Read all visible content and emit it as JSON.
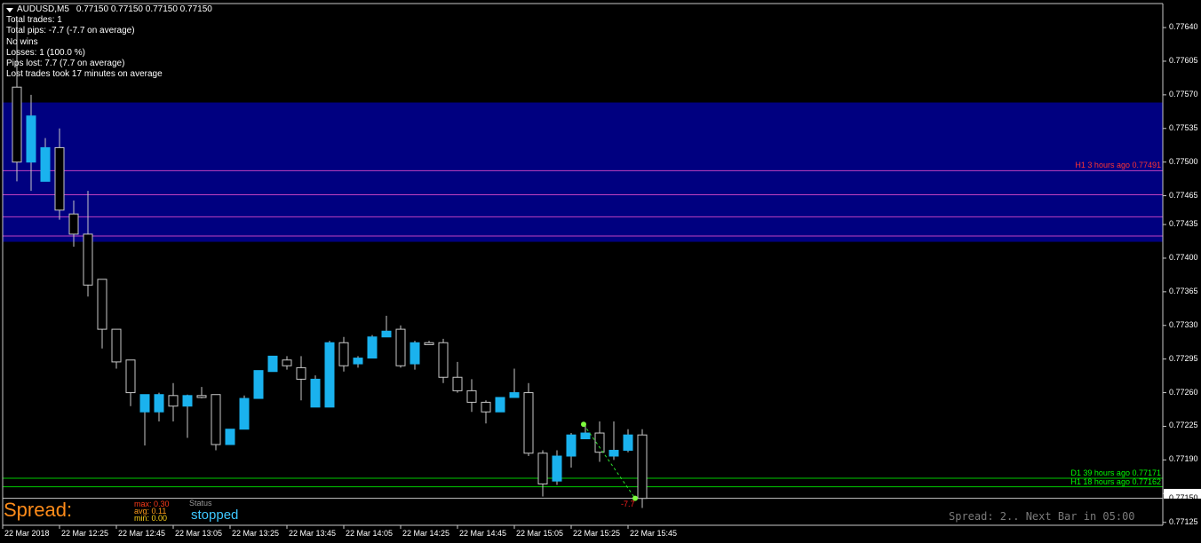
{
  "header": {
    "symbol": "AUDUSD,M5",
    "ohlc": "0.77150 0.77150 0.77150 0.77150",
    "stats": [
      "Total trades: 1",
      "Total pips: -7.7 (-7.7 on average)",
      "No wins",
      "Losses: 1 (100.0 %)",
      "Pips lost: 7.7 (7.7 on average)",
      "Lost trades took 17 minutes on average"
    ]
  },
  "colors": {
    "background": "#000000",
    "zone": "#000080",
    "bull": "#1ab2ee",
    "bear": "#000000",
    "candle_border": "#c8c8c8",
    "magenta_line": "#c040c0",
    "green_line": "#00c800",
    "spread_orange": "#ff8c1a",
    "status_cyan": "#3ec8ff"
  },
  "y_axis": {
    "labels": [
      "0.77640",
      "0.77605",
      "0.77570",
      "0.77535",
      "0.77500",
      "0.77465",
      "0.77435",
      "0.77400",
      "0.77365",
      "0.77330",
      "0.77295",
      "0.77260",
      "0.77225",
      "0.77190",
      "0.77155",
      "0.77125"
    ],
    "current_price": "0.77150"
  },
  "x_axis": {
    "labels": [
      "22 Mar 2018",
      "22 Mar 12:25",
      "22 Mar 12:45",
      "22 Mar 13:05",
      "22 Mar 13:25",
      "22 Mar 13:45",
      "22 Mar 14:05",
      "22 Mar 14:25",
      "22 Mar 14:45",
      "22 Mar 15:05",
      "22 Mar 15:25",
      "22 Mar 15:45"
    ]
  },
  "zone": {
    "from": 0.77417,
    "to": 0.77562
  },
  "magenta_levels": [
    0.77491,
    0.77466,
    0.77443,
    0.77423
  ],
  "levels": [
    {
      "label": "H1 3 hours ago 0.77491",
      "price": 0.77491,
      "color": "#ff3333"
    },
    {
      "label": "D1 39 hours ago 0.77171",
      "price": 0.77171,
      "color": "#00ff00"
    },
    {
      "label": "H1 18 hours ago 0.77162",
      "price": 0.77162,
      "color": "#00ff00"
    }
  ],
  "trade": {
    "entry_price": 0.77227,
    "exit_price": 0.7715,
    "result": "-7.7"
  },
  "spread": {
    "label": "Spread:",
    "max": "max: 0.30",
    "avg": "avg: 0.11",
    "min": "min: 0.00",
    "status_label": "Status",
    "status": "stopped",
    "footer": "Spread: 2.. Next Bar in 05:00"
  },
  "chart_data": {
    "type": "candlestick",
    "symbol": "AUDUSD,M5",
    "ylim": [
      0.77122,
      0.77665
    ],
    "candles": [
      {
        "o": 0.77578,
        "h": 0.7765,
        "l": 0.7748,
        "c": 0.775
      },
      {
        "o": 0.775,
        "h": 0.7757,
        "l": 0.7747,
        "c": 0.77548
      },
      {
        "o": 0.7748,
        "h": 0.77525,
        "l": 0.7748,
        "c": 0.77515
      },
      {
        "o": 0.77515,
        "h": 0.77535,
        "l": 0.7744,
        "c": 0.7745
      },
      {
        "o": 0.77446,
        "h": 0.7746,
        "l": 0.77412,
        "c": 0.77425
      },
      {
        "o": 0.77425,
        "h": 0.7747,
        "l": 0.7736,
        "c": 0.77372
      },
      {
        "o": 0.77378,
        "h": 0.77378,
        "l": 0.77306,
        "c": 0.77326
      },
      {
        "o": 0.77326,
        "h": 0.77326,
        "l": 0.77285,
        "c": 0.77292
      },
      {
        "o": 0.77294,
        "h": 0.77294,
        "l": 0.77246,
        "c": 0.7726
      },
      {
        "o": 0.7724,
        "h": 0.77258,
        "l": 0.77205,
        "c": 0.77258
      },
      {
        "o": 0.7724,
        "h": 0.7726,
        "l": 0.7723,
        "c": 0.77258
      },
      {
        "o": 0.77257,
        "h": 0.7727,
        "l": 0.7723,
        "c": 0.77246
      },
      {
        "o": 0.77246,
        "h": 0.77258,
        "l": 0.77213,
        "c": 0.77257
      },
      {
        "o": 0.77257,
        "h": 0.77266,
        "l": 0.77254,
        "c": 0.77255
      },
      {
        "o": 0.77258,
        "h": 0.77258,
        "l": 0.772,
        "c": 0.77206
      },
      {
        "o": 0.77206,
        "h": 0.77222,
        "l": 0.77206,
        "c": 0.77222
      },
      {
        "o": 0.77222,
        "h": 0.77257,
        "l": 0.77222,
        "c": 0.77254
      },
      {
        "o": 0.77254,
        "h": 0.77283,
        "l": 0.77254,
        "c": 0.77283
      },
      {
        "o": 0.77282,
        "h": 0.77296,
        "l": 0.77282,
        "c": 0.77298
      },
      {
        "o": 0.77294,
        "h": 0.77298,
        "l": 0.77284,
        "c": 0.77288
      },
      {
        "o": 0.77286,
        "h": 0.77298,
        "l": 0.77252,
        "c": 0.77274
      },
      {
        "o": 0.77245,
        "h": 0.77278,
        "l": 0.77245,
        "c": 0.77274
      },
      {
        "o": 0.77245,
        "h": 0.77314,
        "l": 0.77245,
        "c": 0.77312
      },
      {
        "o": 0.77312,
        "h": 0.77318,
        "l": 0.77282,
        "c": 0.77288
      },
      {
        "o": 0.7729,
        "h": 0.77298,
        "l": 0.77286,
        "c": 0.77296
      },
      {
        "o": 0.77296,
        "h": 0.7732,
        "l": 0.77296,
        "c": 0.77318
      },
      {
        "o": 0.77318,
        "h": 0.7734,
        "l": 0.77318,
        "c": 0.77324
      },
      {
        "o": 0.77326,
        "h": 0.7733,
        "l": 0.77286,
        "c": 0.77288
      },
      {
        "o": 0.7729,
        "h": 0.77314,
        "l": 0.77284,
        "c": 0.77312
      },
      {
        "o": 0.77312,
        "h": 0.77314,
        "l": 0.77312,
        "c": 0.7731
      },
      {
        "o": 0.77312,
        "h": 0.77316,
        "l": 0.7727,
        "c": 0.77276
      },
      {
        "o": 0.77276,
        "h": 0.77292,
        "l": 0.7726,
        "c": 0.77262
      },
      {
        "o": 0.77262,
        "h": 0.77274,
        "l": 0.7724,
        "c": 0.7725
      },
      {
        "o": 0.7725,
        "h": 0.77252,
        "l": 0.77228,
        "c": 0.7724
      },
      {
        "o": 0.7724,
        "h": 0.77255,
        "l": 0.7724,
        "c": 0.77255
      },
      {
        "o": 0.77255,
        "h": 0.77285,
        "l": 0.77255,
        "c": 0.7726
      },
      {
        "o": 0.7726,
        "h": 0.7727,
        "l": 0.77194,
        "c": 0.77197
      },
      {
        "o": 0.77197,
        "h": 0.772,
        "l": 0.77152,
        "c": 0.77165
      },
      {
        "o": 0.77168,
        "h": 0.772,
        "l": 0.77164,
        "c": 0.77194
      },
      {
        "o": 0.77194,
        "h": 0.77218,
        "l": 0.77182,
        "c": 0.77216
      },
      {
        "o": 0.77212,
        "h": 0.77228,
        "l": 0.77212,
        "c": 0.77218
      },
      {
        "o": 0.77218,
        "h": 0.7723,
        "l": 0.77188,
        "c": 0.77198
      },
      {
        "o": 0.77194,
        "h": 0.7723,
        "l": 0.7719,
        "c": 0.772
      },
      {
        "o": 0.772,
        "h": 0.77222,
        "l": 0.77198,
        "c": 0.77216
      },
      {
        "o": 0.77216,
        "h": 0.77222,
        "l": 0.7714,
        "c": 0.7715
      }
    ]
  }
}
